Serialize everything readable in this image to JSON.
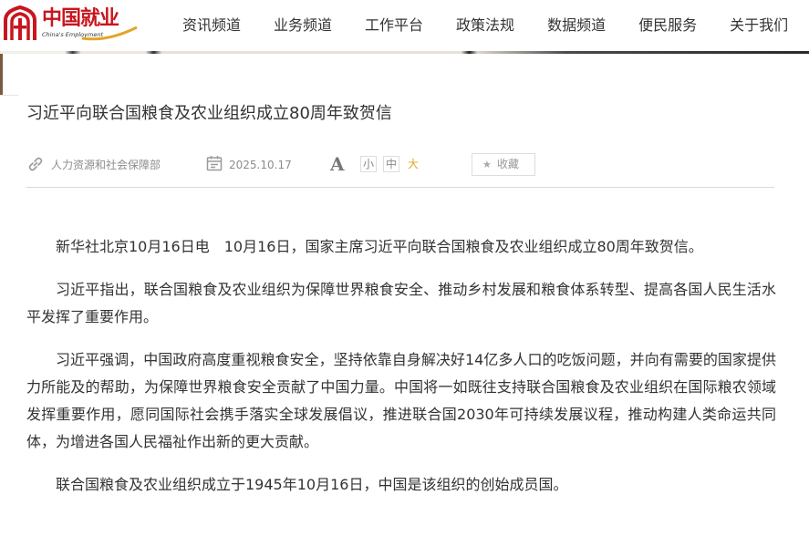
{
  "brand": {
    "name_cn": "中国就业",
    "name_en": "China's Employment",
    "color": "#c8161e"
  },
  "nav": {
    "items": [
      {
        "label": "资讯频道"
      },
      {
        "label": "业务频道"
      },
      {
        "label": "工作平台"
      },
      {
        "label": "政策法规"
      },
      {
        "label": "数据频道"
      },
      {
        "label": "便民服务"
      },
      {
        "label": "关于我们"
      }
    ]
  },
  "article": {
    "title": "习近平向联合国粮食及农业组织成立80周年致贺信",
    "meta": {
      "source": "人力资源和社会保障部",
      "date": "2025.10.17",
      "font_icon": "A",
      "size_small": "小",
      "size_medium": "中",
      "size_large": "大",
      "favorite_label": "收藏",
      "icons": {
        "source": "link-icon",
        "date": "calendar-icon",
        "favorite": "star-icon"
      }
    },
    "paragraphs": [
      "新华社北京10月16日电　10月16日，国家主席习近平向联合国粮食及农业组织成立80周年致贺信。",
      "习近平指出，联合国粮食及农业组织为保障世界粮食安全、推动乡村发展和粮食体系转型、提高各国人民生活水平发挥了重要作用。",
      "习近平强调，中国政府高度重视粮食安全，坚持依靠自身解决好14亿多人口的吃饭问题，并向有需要的国家提供力所能及的帮助，为保障世界粮食安全贡献了中国力量。中国将一如既往支持联合国粮食及农业组织在国际粮农领域发挥重要作用，愿同国际社会携手落实全球发展倡议，推进联合国2030年可持续发展议程，推动构建人类命运共同体，为增进各国人民福祉作出新的更大贡献。",
      "联合国粮食及农业组织成立于1945年10月16日，中国是该组织的创始成员国。"
    ]
  }
}
